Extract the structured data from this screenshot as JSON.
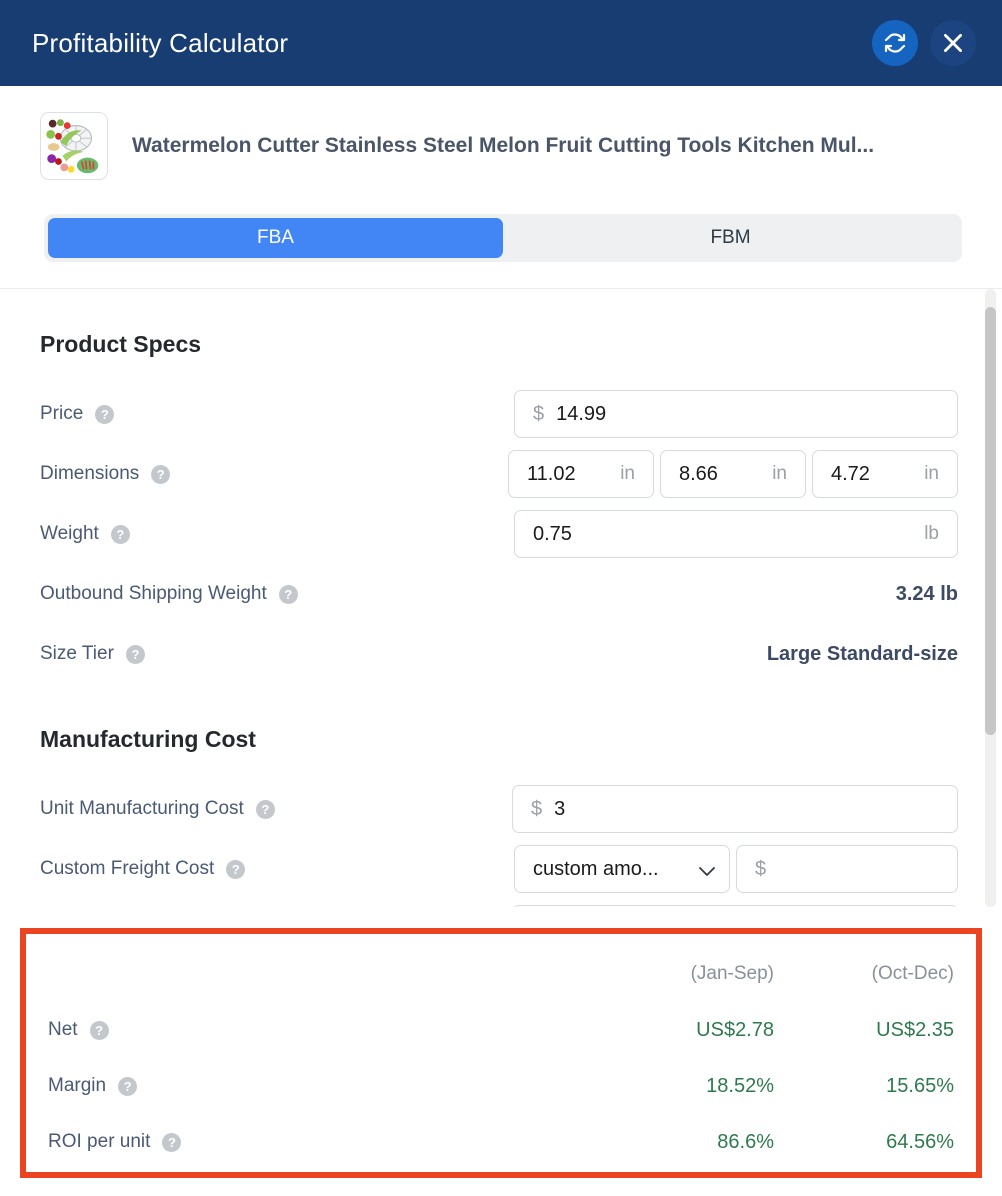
{
  "titlebar": {
    "title": "Profitability Calculator",
    "refresh_icon": "refresh-icon",
    "close_icon": "close-icon"
  },
  "product": {
    "title": "Watermelon Cutter Stainless Steel Melon Fruit Cutting Tools Kitchen Mul...",
    "thumbnail_alt": "watermelon-cutter-product-image"
  },
  "fulfillment_tabs": {
    "options": [
      "FBA",
      "FBM"
    ],
    "selected": "FBA"
  },
  "product_specs": {
    "heading": "Product Specs",
    "price": {
      "label": "Price",
      "currency_symbol": "$",
      "value": "14.99"
    },
    "dimensions": {
      "label": "Dimensions",
      "unit": "in",
      "length": "11.02",
      "width": "8.66",
      "height": "4.72"
    },
    "weight": {
      "label": "Weight",
      "value": "0.75",
      "unit": "lb"
    },
    "outbound_shipping_weight": {
      "label": "Outbound Shipping Weight",
      "value": "3.24 lb"
    },
    "size_tier": {
      "label": "Size Tier",
      "value": "Large Standard-size"
    }
  },
  "manufacturing_cost": {
    "heading": "Manufacturing Cost",
    "unit_manufacturing_cost": {
      "label": "Unit Manufacturing Cost",
      "currency_symbol": "$",
      "value": "3"
    },
    "custom_freight_cost": {
      "label": "Custom Freight Cost",
      "select_value": "custom amo...",
      "select_options": [
        "custom amount"
      ],
      "currency_symbol": "$",
      "amount_value": "",
      "amount_placeholder": ""
    }
  },
  "results": {
    "columns": [
      "(Jan-Sep)",
      "(Oct-Dec)"
    ],
    "rows": [
      {
        "label": "Net",
        "jan_sep": "US$2.78",
        "oct_dec": "US$2.35"
      },
      {
        "label": "Margin",
        "jan_sep": "18.52%",
        "oct_dec": "15.65%"
      },
      {
        "label": "ROI per unit",
        "jan_sep": "86.6%",
        "oct_dec": "64.56%"
      }
    ],
    "highlight_color": "#eb4420",
    "value_color": "#2e7a4d"
  },
  "colors": {
    "header_navy": "#173d72",
    "accent_blue": "#4285f4",
    "label_slate": "#4a5a74"
  }
}
